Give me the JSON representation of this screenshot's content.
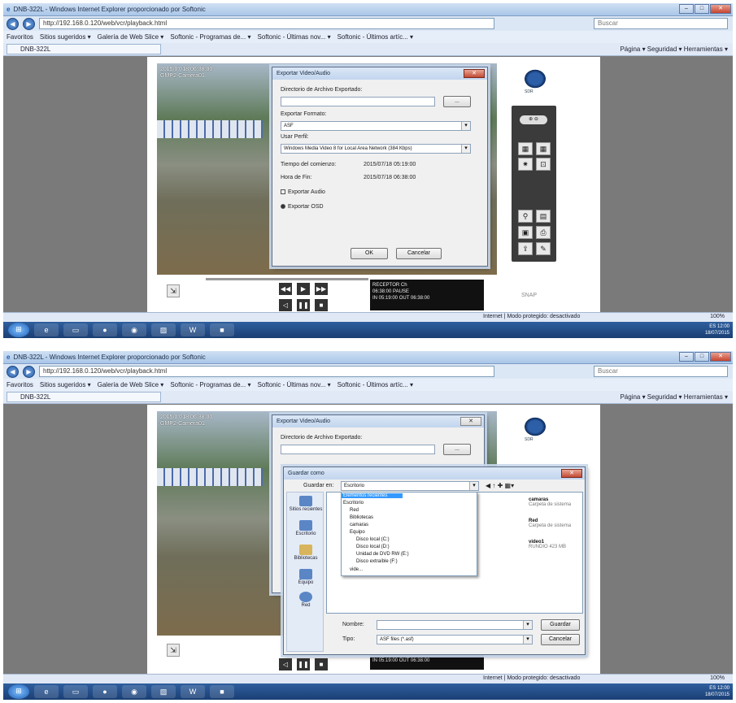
{
  "browser": {
    "title": "DNB-322L - Windows Internet Explorer proporcionado por Softonic",
    "url": "http://192.168.0.120/web/vcr/playback.html",
    "search_placeholder": "Buscar",
    "favorites": [
      "Favoritos",
      "Sitios sugeridos ▾",
      "Galería de Web Slice ▾",
      "Softonic - Programas de... ▾",
      "Softonic - Últimas nov... ▾",
      "Softonic - Últimos artíc... ▾"
    ],
    "tab": "DNB-322L",
    "commands": "Página ▾  Seguridad ▾  Herramientas ▾",
    "status": "Internet | Modo protegido: desactivado",
    "zoom": "100%",
    "win_min": "–",
    "win_max": "□",
    "win_close": "✕"
  },
  "camera": {
    "overlay": [
      "2015/07/18 06:38:00",
      "GMP2-Camera01"
    ],
    "logo_text": "SDR"
  },
  "player": {
    "info1": [
      "RECEPTOR",
      "06:38:00",
      "Ch",
      "PAUSE"
    ],
    "info2": [
      "IN 05:19:00",
      "OUT 06:38:00"
    ],
    "sidebar_pill": "⊕ ⊖",
    "snap_label": "SNAP"
  },
  "export_dialog": {
    "title": "Exportar Video/Audio",
    "dir_label": "Directorio de Archivo Exportado:",
    "dir_value": "",
    "browse_btn": "...",
    "format_label": "Exportar Formato:",
    "format_value": "ASF",
    "profile_label": "Usar Perfil:",
    "profile_value": "Windows Media Video 8 for Local Area Network (384 Kbps)",
    "start_label": "Tiempo del comienzo:",
    "start_value": "2015/07/18 05:19:00",
    "end_label": "Hora de Fin:",
    "end_value": "2015/07/18 06:38:00",
    "audio_label": "Exportar Audio",
    "osd_label": "Exportar OSD",
    "ok": "OK",
    "cancel": "Cancelar"
  },
  "save_dialog": {
    "title": "Guardar como",
    "save_in_label": "Guardar en:",
    "save_in_value": "Escritorio",
    "places": [
      "Sitios recientes",
      "Escritorio",
      "Bibliotecas",
      "Equipo",
      "Red"
    ],
    "dropdown_items": [
      "Elementos recientes",
      "Escritorio",
      "Red",
      "Bibliotecas",
      "camaras",
      "Equipo",
      "Disco local (C:)",
      "Disco local (D:)",
      "Unidad de DVD RW (E:)",
      "Disco extraíble (F:)",
      "vide..."
    ],
    "files": [
      {
        "name": "camaras",
        "desc": "Carpeta de sistema"
      },
      {
        "name": "Red",
        "desc": "Carpeta de sistema"
      },
      {
        "name": "video1",
        "desc": "RUNDIO 423 MB"
      }
    ],
    "name_label": "Nombre:",
    "name_value": "",
    "type_label": "Tipo:",
    "type_value": "ASF files (*.asf)",
    "save_btn": "Guardar",
    "cancel_btn": "Cancelar"
  },
  "tray": {
    "time": "12:00",
    "date": "18/07/2015",
    "lang": "ES"
  }
}
